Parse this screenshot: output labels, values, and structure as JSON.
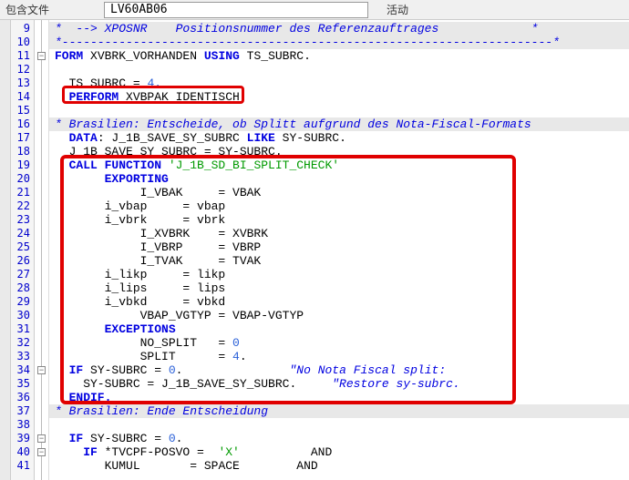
{
  "toolbar": {
    "label": "包含文件",
    "program_name": "LV60AB06",
    "status": "活动"
  },
  "gutter": {
    "lines": [
      "9",
      "10",
      "11",
      "12",
      "13",
      "14",
      "15",
      "16",
      "17",
      "18",
      "19",
      "20",
      "21",
      "22",
      "23",
      "24",
      "25",
      "26",
      "27",
      "28",
      "29",
      "30",
      "31",
      "32",
      "33",
      "34",
      "35",
      "36",
      "37",
      "38",
      "39",
      "40",
      "41"
    ]
  },
  "code": {
    "l9": "*  --> XPOSNR    Positionsnummer des Referenzauftrages             *",
    "l10": "*---------------------------------------------------------------------*",
    "l11a": "FORM",
    "l11b": " XVBRK_VORHANDEN ",
    "l11c": "USING",
    "l11d": " TS_SUBRC.",
    "l13a": "  TS_SUBRC ",
    "l13b": "=",
    "l13c": " 4.",
    "l14a": "  PERFORM",
    "l14b": " XVBPAK_IDENTISCH.",
    "l16": "* Brasilien: Entscheide, ob Splitt aufgrund des Nota-Fiscal-Formats",
    "l17a": "  DATA",
    "l17b": ": J_1B_SAVE_SY_SUBRC ",
    "l17c": "LIKE",
    "l17d": " SY-SUBRC.",
    "l18": "  J_1B_SAVE_SY_SUBRC = SY-SUBRC.",
    "l19a": "  CALL FUNCTION ",
    "l19b": "'J_1B_SD_BI_SPLIT_CHECK'",
    "l20": "       EXPORTING",
    "l21": "            I_VBAK     = VBAK",
    "l22": "       i_vbap     = vbap",
    "l23": "       i_vbrk     = vbrk",
    "l24": "            I_XVBRK    = XVBRK",
    "l25": "            I_VBRP     = VBRP",
    "l26": "            I_TVAK     = TVAK",
    "l27": "       i_likp     = likp",
    "l28": "       i_lips     = lips",
    "l29": "       i_vbkd     = vbkd",
    "l30": "            VBAP_VGTYP = VBAP-VGTYP",
    "l31": "       EXCEPTIONS",
    "l32a": "            NO_SPLIT   = ",
    "l32b": "0",
    "l33a": "            SPLIT      = ",
    "l33b": "4",
    "l33c": ".",
    "l34a": "  IF",
    "l34b": " SY-SUBRC ",
    "l34c": "=",
    "l34d": " 0",
    "l34e": ".",
    "l34f": "               \"No Nota Fiscal split:",
    "l35a": "    SY-SUBRC = J_1B_SAVE_SY_SUBRC.",
    "l35b": "     \"Restore sy-subrc.",
    "l36": "  ENDIF.",
    "l37": "* Brasilien: Ende Entscheidung",
    "l39a": "  IF",
    "l39b": " SY-SUBRC ",
    "l39c": "=",
    "l39d": " 0",
    "l39e": ".",
    "l40a": "    IF",
    "l40b": " *TVCPF-POSVO ",
    "l40c": "=",
    "l40d": "  'X'",
    "l40e": "          AND",
    "l41a": "       KUMUL       ",
    "l41b": "=",
    "l41c": " SPACE        AND"
  }
}
